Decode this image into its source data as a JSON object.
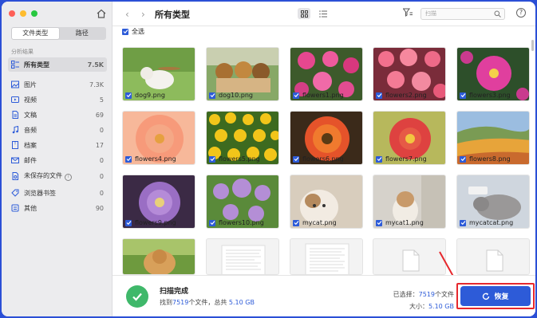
{
  "sidebar": {
    "tabs": [
      "文件类型",
      "路径"
    ],
    "section_label": "分析结果",
    "items": [
      {
        "label": "所有类型",
        "count": "7.5K",
        "icon": "grid-list-icon"
      },
      {
        "label": "图片",
        "count": "7.3K",
        "icon": "image-icon"
      },
      {
        "label": "视频",
        "count": "5",
        "icon": "video-icon"
      },
      {
        "label": "文稿",
        "count": "69",
        "icon": "document-icon"
      },
      {
        "label": "音频",
        "count": "0",
        "icon": "music-icon"
      },
      {
        "label": "档案",
        "count": "17",
        "icon": "archive-icon"
      },
      {
        "label": "邮件",
        "count": "0",
        "icon": "mail-icon"
      },
      {
        "label": "未保存的文件",
        "count": "0",
        "icon": "unsaved-file-icon"
      },
      {
        "label": "浏览器书签",
        "count": "0",
        "icon": "bookmark-icon"
      },
      {
        "label": "其他",
        "count": "90",
        "icon": "other-icon"
      }
    ]
  },
  "toolbar": {
    "title": "所有类型",
    "search_placeholder": "扫描"
  },
  "select_all_label": "全选",
  "files": [
    {
      "name": "dog9.png"
    },
    {
      "name": "dog10.png"
    },
    {
      "name": "flowers1.png"
    },
    {
      "name": "flowers2.png"
    },
    {
      "name": "flowers3.png"
    },
    {
      "name": "flowers4.png"
    },
    {
      "name": "flowers5.png"
    },
    {
      "name": "flowers6.png"
    },
    {
      "name": "flowers7.png"
    },
    {
      "name": "flowers8.png"
    },
    {
      "name": "flowers9.png"
    },
    {
      "name": "flowers10.png"
    },
    {
      "name": "mycat.png"
    },
    {
      "name": "mycat1.png"
    },
    {
      "name": "mycatcat.png"
    }
  ],
  "status": {
    "title": "扫描完成",
    "found_prefix": "找到",
    "found_count": "7519",
    "found_mid": "个文件，总共",
    "found_size": "5.10 GB",
    "selected_label": "已选择：",
    "selected_count": "7519",
    "selected_unit": "个文件",
    "size_label": "大小：",
    "size_value": "5.10 GB"
  },
  "recover_button": "恢复",
  "colors": {
    "accent": "#2d5bd8",
    "success": "#3fb86a",
    "highlight": "#e6282d"
  }
}
